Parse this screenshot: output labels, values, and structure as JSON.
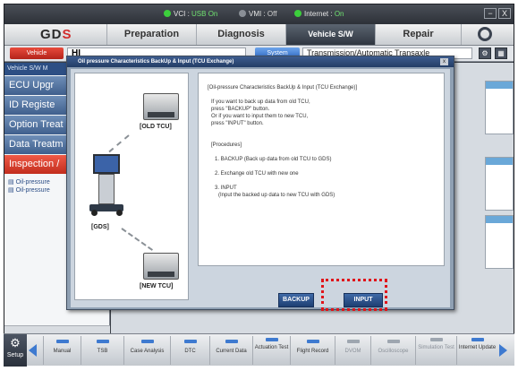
{
  "statusbar": {
    "vci_label": "VCI",
    "vci_value": "USB On",
    "vmi_label": "VMI",
    "vmi_value": "Off",
    "internet_label": "Internet",
    "internet_value": "On",
    "minimize": "−",
    "close": "X",
    "colors": {
      "on": "#3ccf3c",
      "off": "#8a8f96"
    }
  },
  "app": {
    "logo_left": "GD",
    "logo_right": "S",
    "menu": [
      "Preparation",
      "Diagnosis",
      "Vehicle S/W Management",
      "Repair"
    ],
    "active_menu": "Vehicle S/W Management",
    "search_icon": "search-icon"
  },
  "vehicle": {
    "tag": "Vehicle",
    "name": "HI",
    "system_tag": "System",
    "system": "Transmission/Automatic Transaxle"
  },
  "leftpanel": {
    "title": "Vehicle S/W M",
    "items": [
      "ECU Upgr",
      "ID Registe",
      "Option Treat",
      "Data Treatm",
      "Inspection /"
    ],
    "active_index": 4,
    "sub_items": [
      "Oil-pressure",
      "Oil-pressure"
    ]
  },
  "dialog": {
    "title": "Oil pressure Characteristics BackUp & Input (TCU Exchange)",
    "close": "x",
    "labels": {
      "old_tcu": "[OLD TCU]",
      "gds": "[GDS]",
      "new_tcu": "[NEW TCU]"
    },
    "text": {
      "heading": "[Oil-pressure Characteristics BackUp & Input (TCU Exchange)]",
      "intro": [
        "If you want to back up data from old TCU,",
        "press \"BACKUP\" button.",
        "Or if you want to input them to new TCU,",
        "press \"INPUT\" button."
      ],
      "procedures_title": "[Procedures]",
      "steps": [
        "1. BACKUP (Back up data from old TCU to GDS)",
        "2. Exchange old TCU with new one",
        "3. INPUT"
      ],
      "step3_detail": "(Input the backed up data to new TCU with GDS)"
    },
    "buttons": {
      "backup": "BACKUP",
      "input": "INPUT"
    },
    "highlight_color": "#e0141a"
  },
  "toolbar": {
    "setup": "Setup",
    "items": [
      {
        "label": "Manual",
        "enabled": true
      },
      {
        "label": "TSB",
        "enabled": true
      },
      {
        "label": "Case Analysis",
        "enabled": true
      },
      {
        "label": "DTC",
        "enabled": true
      },
      {
        "label": "Current Data",
        "enabled": true
      },
      {
        "label": "Actuation Test",
        "enabled": true
      },
      {
        "label": "Flight Record",
        "enabled": true
      },
      {
        "label": "DVOM",
        "enabled": false
      },
      {
        "label": "Oscilloscope",
        "enabled": false
      },
      {
        "label": "Simulation Test",
        "enabled": false
      },
      {
        "label": "Internet Update",
        "enabled": true
      }
    ]
  }
}
